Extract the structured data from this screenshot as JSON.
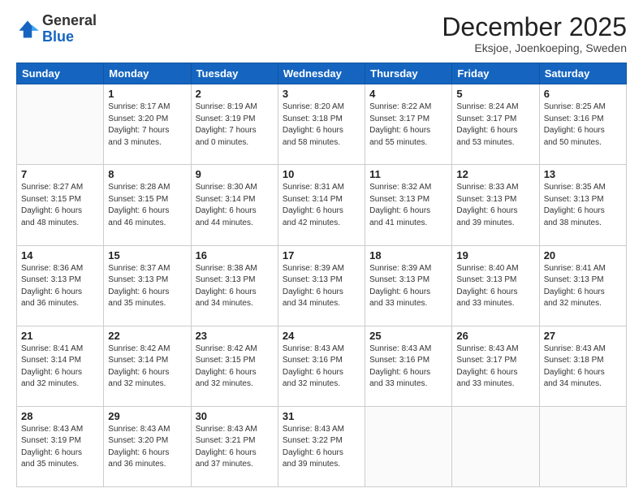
{
  "logo": {
    "general": "General",
    "blue": "Blue"
  },
  "header": {
    "month": "December 2025",
    "location": "Eksjoe, Joenkoeping, Sweden"
  },
  "days_of_week": [
    "Sunday",
    "Monday",
    "Tuesday",
    "Wednesday",
    "Thursday",
    "Friday",
    "Saturday"
  ],
  "weeks": [
    [
      {
        "day": "",
        "info": ""
      },
      {
        "day": "1",
        "info": "Sunrise: 8:17 AM\nSunset: 3:20 PM\nDaylight: 7 hours\nand 3 minutes."
      },
      {
        "day": "2",
        "info": "Sunrise: 8:19 AM\nSunset: 3:19 PM\nDaylight: 7 hours\nand 0 minutes."
      },
      {
        "day": "3",
        "info": "Sunrise: 8:20 AM\nSunset: 3:18 PM\nDaylight: 6 hours\nand 58 minutes."
      },
      {
        "day": "4",
        "info": "Sunrise: 8:22 AM\nSunset: 3:17 PM\nDaylight: 6 hours\nand 55 minutes."
      },
      {
        "day": "5",
        "info": "Sunrise: 8:24 AM\nSunset: 3:17 PM\nDaylight: 6 hours\nand 53 minutes."
      },
      {
        "day": "6",
        "info": "Sunrise: 8:25 AM\nSunset: 3:16 PM\nDaylight: 6 hours\nand 50 minutes."
      }
    ],
    [
      {
        "day": "7",
        "info": "Sunrise: 8:27 AM\nSunset: 3:15 PM\nDaylight: 6 hours\nand 48 minutes."
      },
      {
        "day": "8",
        "info": "Sunrise: 8:28 AM\nSunset: 3:15 PM\nDaylight: 6 hours\nand 46 minutes."
      },
      {
        "day": "9",
        "info": "Sunrise: 8:30 AM\nSunset: 3:14 PM\nDaylight: 6 hours\nand 44 minutes."
      },
      {
        "day": "10",
        "info": "Sunrise: 8:31 AM\nSunset: 3:14 PM\nDaylight: 6 hours\nand 42 minutes."
      },
      {
        "day": "11",
        "info": "Sunrise: 8:32 AM\nSunset: 3:13 PM\nDaylight: 6 hours\nand 41 minutes."
      },
      {
        "day": "12",
        "info": "Sunrise: 8:33 AM\nSunset: 3:13 PM\nDaylight: 6 hours\nand 39 minutes."
      },
      {
        "day": "13",
        "info": "Sunrise: 8:35 AM\nSunset: 3:13 PM\nDaylight: 6 hours\nand 38 minutes."
      }
    ],
    [
      {
        "day": "14",
        "info": "Sunrise: 8:36 AM\nSunset: 3:13 PM\nDaylight: 6 hours\nand 36 minutes."
      },
      {
        "day": "15",
        "info": "Sunrise: 8:37 AM\nSunset: 3:13 PM\nDaylight: 6 hours\nand 35 minutes."
      },
      {
        "day": "16",
        "info": "Sunrise: 8:38 AM\nSunset: 3:13 PM\nDaylight: 6 hours\nand 34 minutes."
      },
      {
        "day": "17",
        "info": "Sunrise: 8:39 AM\nSunset: 3:13 PM\nDaylight: 6 hours\nand 34 minutes."
      },
      {
        "day": "18",
        "info": "Sunrise: 8:39 AM\nSunset: 3:13 PM\nDaylight: 6 hours\nand 33 minutes."
      },
      {
        "day": "19",
        "info": "Sunrise: 8:40 AM\nSunset: 3:13 PM\nDaylight: 6 hours\nand 33 minutes."
      },
      {
        "day": "20",
        "info": "Sunrise: 8:41 AM\nSunset: 3:13 PM\nDaylight: 6 hours\nand 32 minutes."
      }
    ],
    [
      {
        "day": "21",
        "info": "Sunrise: 8:41 AM\nSunset: 3:14 PM\nDaylight: 6 hours\nand 32 minutes."
      },
      {
        "day": "22",
        "info": "Sunrise: 8:42 AM\nSunset: 3:14 PM\nDaylight: 6 hours\nand 32 minutes."
      },
      {
        "day": "23",
        "info": "Sunrise: 8:42 AM\nSunset: 3:15 PM\nDaylight: 6 hours\nand 32 minutes."
      },
      {
        "day": "24",
        "info": "Sunrise: 8:43 AM\nSunset: 3:16 PM\nDaylight: 6 hours\nand 32 minutes."
      },
      {
        "day": "25",
        "info": "Sunrise: 8:43 AM\nSunset: 3:16 PM\nDaylight: 6 hours\nand 33 minutes."
      },
      {
        "day": "26",
        "info": "Sunrise: 8:43 AM\nSunset: 3:17 PM\nDaylight: 6 hours\nand 33 minutes."
      },
      {
        "day": "27",
        "info": "Sunrise: 8:43 AM\nSunset: 3:18 PM\nDaylight: 6 hours\nand 34 minutes."
      }
    ],
    [
      {
        "day": "28",
        "info": "Sunrise: 8:43 AM\nSunset: 3:19 PM\nDaylight: 6 hours\nand 35 minutes."
      },
      {
        "day": "29",
        "info": "Sunrise: 8:43 AM\nSunset: 3:20 PM\nDaylight: 6 hours\nand 36 minutes."
      },
      {
        "day": "30",
        "info": "Sunrise: 8:43 AM\nSunset: 3:21 PM\nDaylight: 6 hours\nand 37 minutes."
      },
      {
        "day": "31",
        "info": "Sunrise: 8:43 AM\nSunset: 3:22 PM\nDaylight: 6 hours\nand 39 minutes."
      },
      {
        "day": "",
        "info": ""
      },
      {
        "day": "",
        "info": ""
      },
      {
        "day": "",
        "info": ""
      }
    ]
  ]
}
